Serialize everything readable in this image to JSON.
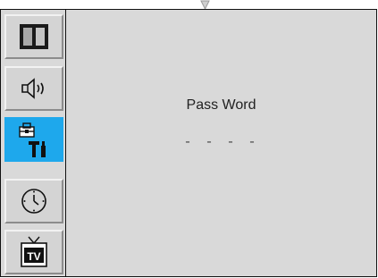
{
  "sidebar": {
    "items": [
      {
        "name": "picture",
        "icon": "picture-icon",
        "selected": false
      },
      {
        "name": "sound",
        "icon": "speaker-icon",
        "selected": false
      },
      {
        "name": "setup",
        "icon": "tools-icon",
        "selected": true
      },
      {
        "name": "timer",
        "icon": "clock-icon",
        "selected": false
      },
      {
        "name": "tv",
        "icon": "tv-icon",
        "selected": false,
        "label": "TV"
      }
    ]
  },
  "main": {
    "password_label": "Pass Word",
    "password_value": "- - - -"
  },
  "colors": {
    "selected_bg": "#1ea8ec",
    "panel_bg": "#d9d9d9"
  }
}
